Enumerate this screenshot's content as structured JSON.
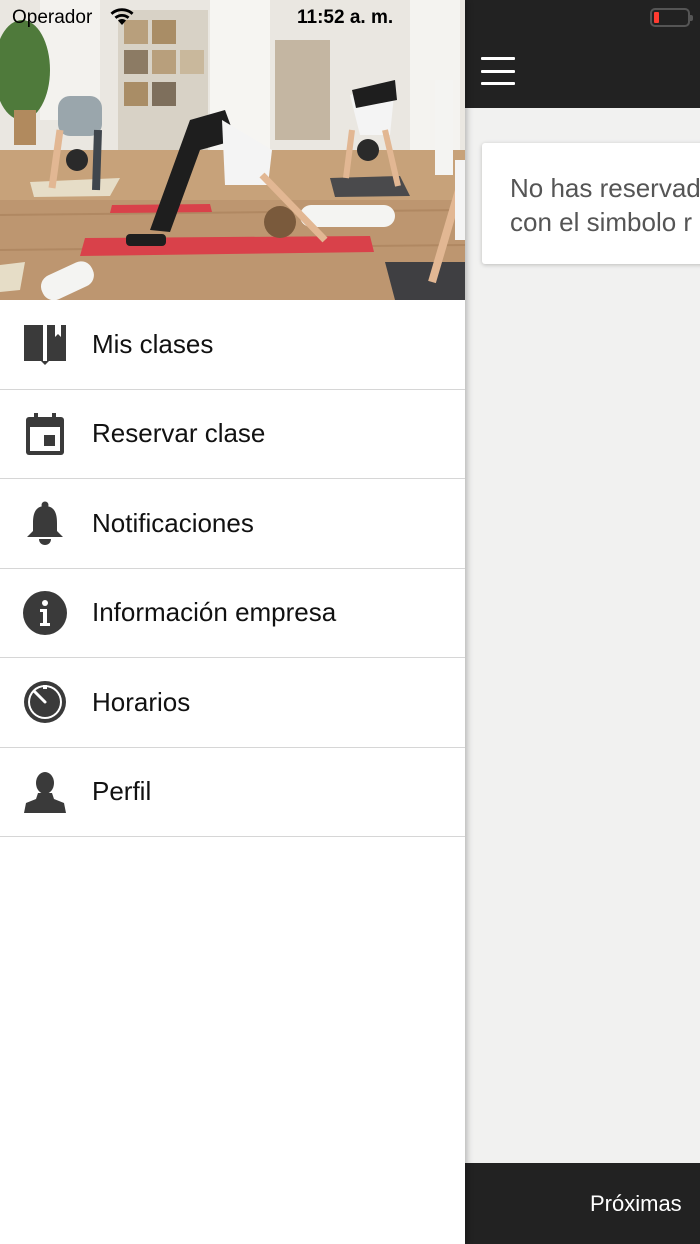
{
  "status_bar": {
    "carrier": "Operador",
    "time": "11:52 a. m."
  },
  "main": {
    "notice_text_line1": "No has reservado",
    "notice_text_line2": "con el simbolo r",
    "bottom_tab_label": "Próximas"
  },
  "drawer": {
    "items": [
      {
        "label": "Mis clases",
        "icon": "book-icon"
      },
      {
        "label": "Reservar clase",
        "icon": "calendar-icon"
      },
      {
        "label": "Notificaciones",
        "icon": "bell-icon"
      },
      {
        "label": "Información empresa",
        "icon": "info-icon"
      },
      {
        "label": "Horarios",
        "icon": "clock-icon"
      },
      {
        "label": "Perfil",
        "icon": "person-icon"
      }
    ]
  },
  "colors": {
    "topbar": "#222222",
    "icon": "#3a3a3a",
    "background": "#f1f1f0",
    "mat_red": "#d9414a"
  }
}
